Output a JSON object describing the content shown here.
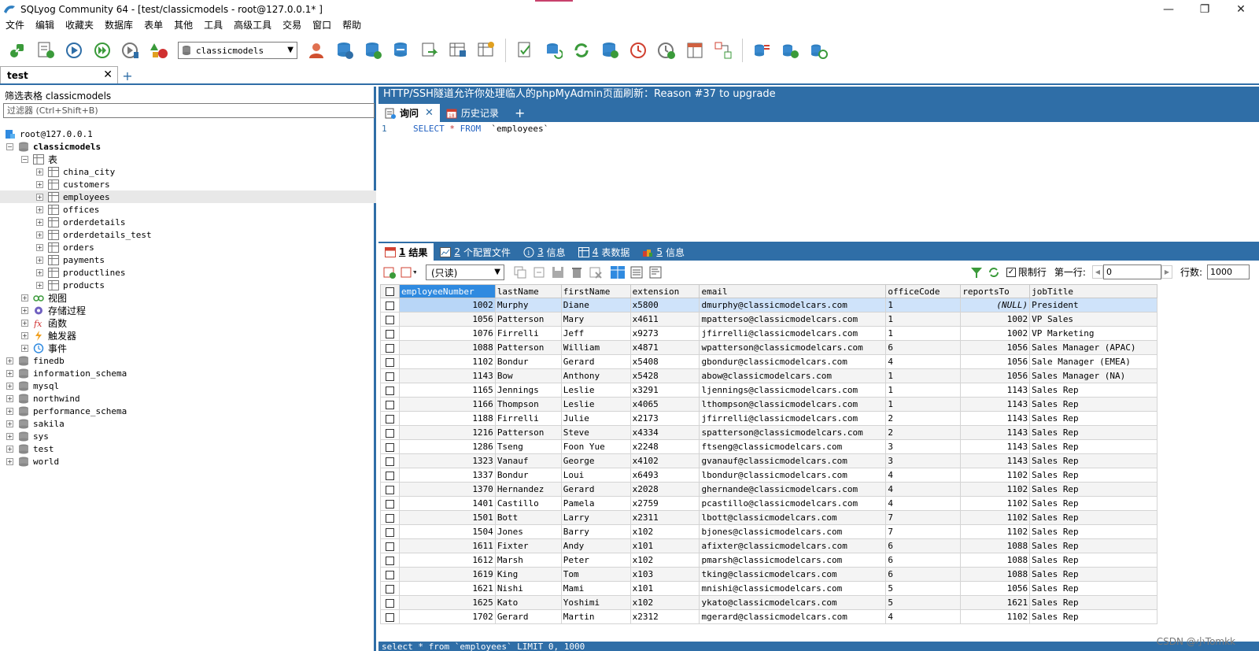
{
  "window": {
    "title": "SQLyog Community 64 - [test/classicmodels - root@127.0.0.1* ]",
    "minimize": "—",
    "restore": "❐",
    "close": "✕"
  },
  "menu": [
    "文件",
    "编辑",
    "收藏夹",
    "数据库",
    "表单",
    "其他",
    "工具",
    "高级工具",
    "交易",
    "窗口",
    "帮助"
  ],
  "toolbar": {
    "database_select": "classicmodels"
  },
  "connection_tab": {
    "label": "test",
    "close": "✕",
    "add": "+"
  },
  "left_panel": {
    "filter_label": "筛选表格 classicmodels",
    "filter_placeholder": "过滤器 (Ctrl+Shift+B)",
    "tree": {
      "root": "root@127.0.0.1",
      "current_db": "classicmodels",
      "tables_folder": "表",
      "tables": [
        "china_city",
        "customers",
        "employees",
        "offices",
        "orderdetails",
        "orderdetails_test",
        "orders",
        "payments",
        "productlines",
        "products"
      ],
      "selected_table": "employees",
      "folders": [
        "视图",
        "存储过程",
        "函数",
        "触发器",
        "事件"
      ],
      "other_dbs": [
        "finedb",
        "information_schema",
        "mysql",
        "northwind",
        "performance_schema",
        "sakila",
        "sys",
        "test",
        "world"
      ]
    }
  },
  "notice": "HTTP/SSH隧道允许你处理临人的phpMyAdmin页面刷新：Reason #37 to upgrade",
  "query_tabs": {
    "query": "询问",
    "history": "历史记录",
    "close": "✕",
    "add": "+"
  },
  "editor": {
    "line_number": "1",
    "kw_select": "SELECT",
    "star": "*",
    "kw_from": "FROM",
    "table": "`employees`"
  },
  "result_tabs": [
    {
      "num": "1",
      "label": "结果"
    },
    {
      "num": "2",
      "label": "个配置文件"
    },
    {
      "num": "3",
      "label": "信息"
    },
    {
      "num": "4",
      "label": "表数据"
    },
    {
      "num": "5",
      "label": "信息"
    }
  ],
  "grid_toolbar": {
    "mode": "(只读)",
    "limit_label": "限制行",
    "first_row_label": "第一行:",
    "first_row_value": "0",
    "rows_label": "行数:",
    "rows_value": "1000"
  },
  "grid": {
    "columns": [
      "employeeNumber",
      "lastName",
      "firstName",
      "extension",
      "email",
      "officeCode",
      "reportsTo",
      "jobTitle"
    ],
    "rows": [
      [
        "1002",
        "Murphy",
        "Diane",
        "x5800",
        "dmurphy@classicmodelcars.com",
        "1",
        "(NULL)",
        "President"
      ],
      [
        "1056",
        "Patterson",
        "Mary",
        "x4611",
        "mpatterso@classicmodelcars.com",
        "1",
        "1002",
        "VP Sales"
      ],
      [
        "1076",
        "Firrelli",
        "Jeff",
        "x9273",
        "jfirrelli@classicmodelcars.com",
        "1",
        "1002",
        "VP Marketing"
      ],
      [
        "1088",
        "Patterson",
        "William",
        "x4871",
        "wpatterson@classicmodelcars.com",
        "6",
        "1056",
        "Sales Manager (APAC)"
      ],
      [
        "1102",
        "Bondur",
        "Gerard",
        "x5408",
        "gbondur@classicmodelcars.com",
        "4",
        "1056",
        "Sale Manager (EMEA)"
      ],
      [
        "1143",
        "Bow",
        "Anthony",
        "x5428",
        "abow@classicmodelcars.com",
        "1",
        "1056",
        "Sales Manager (NA)"
      ],
      [
        "1165",
        "Jennings",
        "Leslie",
        "x3291",
        "ljennings@classicmodelcars.com",
        "1",
        "1143",
        "Sales Rep"
      ],
      [
        "1166",
        "Thompson",
        "Leslie",
        "x4065",
        "lthompson@classicmodelcars.com",
        "1",
        "1143",
        "Sales Rep"
      ],
      [
        "1188",
        "Firrelli",
        "Julie",
        "x2173",
        "jfirrelli@classicmodelcars.com",
        "2",
        "1143",
        "Sales Rep"
      ],
      [
        "1216",
        "Patterson",
        "Steve",
        "x4334",
        "spatterson@classicmodelcars.com",
        "2",
        "1143",
        "Sales Rep"
      ],
      [
        "1286",
        "Tseng",
        "Foon Yue",
        "x2248",
        "ftseng@classicmodelcars.com",
        "3",
        "1143",
        "Sales Rep"
      ],
      [
        "1323",
        "Vanauf",
        "George",
        "x4102",
        "gvanauf@classicmodelcars.com",
        "3",
        "1143",
        "Sales Rep"
      ],
      [
        "1337",
        "Bondur",
        "Loui",
        "x6493",
        "lbondur@classicmodelcars.com",
        "4",
        "1102",
        "Sales Rep"
      ],
      [
        "1370",
        "Hernandez",
        "Gerard",
        "x2028",
        "ghernande@classicmodelcars.com",
        "4",
        "1102",
        "Sales Rep"
      ],
      [
        "1401",
        "Castillo",
        "Pamela",
        "x2759",
        "pcastillo@classicmodelcars.com",
        "4",
        "1102",
        "Sales Rep"
      ],
      [
        "1501",
        "Bott",
        "Larry",
        "x2311",
        "lbott@classicmodelcars.com",
        "7",
        "1102",
        "Sales Rep"
      ],
      [
        "1504",
        "Jones",
        "Barry",
        "x102",
        "bjones@classicmodelcars.com",
        "7",
        "1102",
        "Sales Rep"
      ],
      [
        "1611",
        "Fixter",
        "Andy",
        "x101",
        "afixter@classicmodelcars.com",
        "6",
        "1088",
        "Sales Rep"
      ],
      [
        "1612",
        "Marsh",
        "Peter",
        "x102",
        "pmarsh@classicmodelcars.com",
        "6",
        "1088",
        "Sales Rep"
      ],
      [
        "1619",
        "King",
        "Tom",
        "x103",
        "tking@classicmodelcars.com",
        "6",
        "1088",
        "Sales Rep"
      ],
      [
        "1621",
        "Nishi",
        "Mami",
        "x101",
        "mnishi@classicmodelcars.com",
        "5",
        "1056",
        "Sales Rep"
      ],
      [
        "1625",
        "Kato",
        "Yoshimi",
        "x102",
        "ykato@classicmodelcars.com",
        "5",
        "1621",
        "Sales Rep"
      ],
      [
        "1702",
        "Gerard",
        "Martin",
        "x2312",
        "mgerard@classicmodelcars.com",
        "4",
        "1102",
        "Sales Rep"
      ]
    ]
  },
  "status_text": "select * from `employees` LIMIT 0, 1000",
  "watermark": "CSDN @小Tomkk",
  "colors": {
    "accent_blue": "#2f6ea7",
    "selected_header": "#2f8ae0",
    "selected_row": "#cfe3fa"
  }
}
